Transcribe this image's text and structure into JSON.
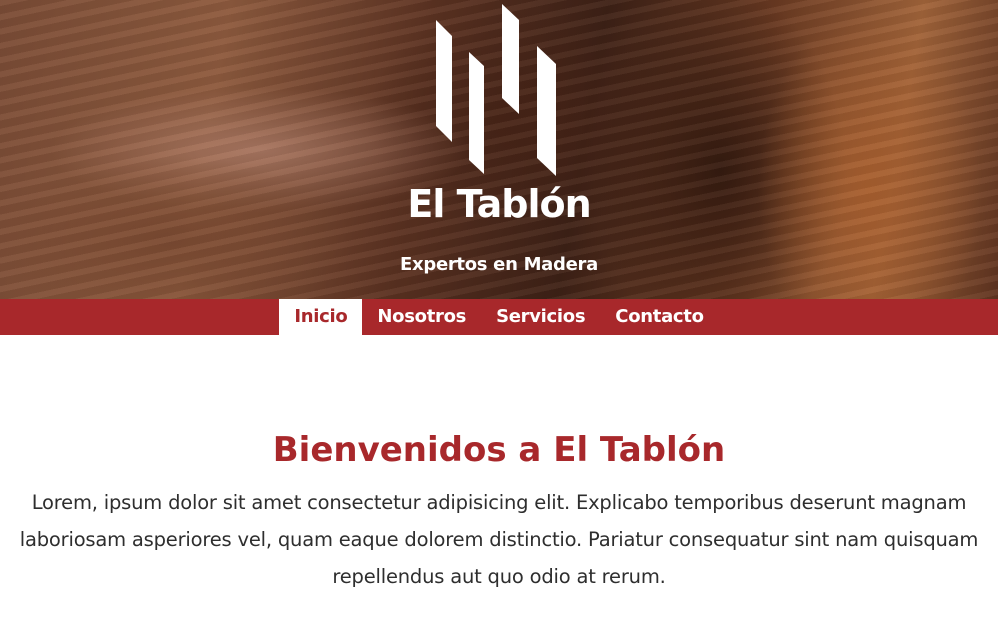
{
  "header": {
    "logo_icon": "wood-planks-logo",
    "site_title": "El Tablón",
    "tagline": "Expertos en Madera"
  },
  "nav": {
    "active_index": 0,
    "items": [
      {
        "label": "Inicio"
      },
      {
        "label": "Nosotros"
      },
      {
        "label": "Servicios"
      },
      {
        "label": "Contacto"
      }
    ]
  },
  "main": {
    "heading": "Bienvenidos a El Tablón",
    "intro": "Lorem, ipsum dolor sit amet consectetur adipisicing elit. Explicabo temporibus deserunt magnam laboriosam asperiores vel, quam eaque dolorem distinctio. Pariatur consequatur sint nam quisquam repellendus aut quo odio at rerum."
  },
  "colors": {
    "brand_red": "#a8282b",
    "text": "#2e2e2e",
    "white": "#ffffff"
  }
}
